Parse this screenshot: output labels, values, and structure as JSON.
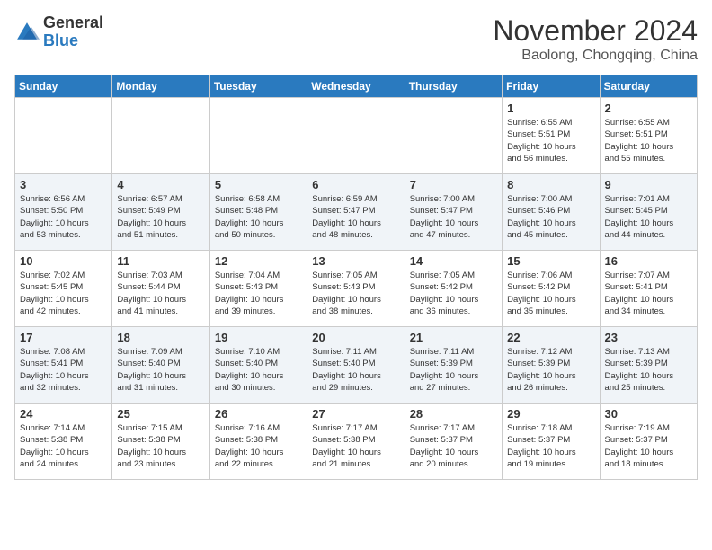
{
  "header": {
    "logo_general": "General",
    "logo_blue": "Blue",
    "month_title": "November 2024",
    "location": "Baolong, Chongqing, China"
  },
  "days_of_week": [
    "Sunday",
    "Monday",
    "Tuesday",
    "Wednesday",
    "Thursday",
    "Friday",
    "Saturday"
  ],
  "weeks": [
    [
      {
        "day": "",
        "info": ""
      },
      {
        "day": "",
        "info": ""
      },
      {
        "day": "",
        "info": ""
      },
      {
        "day": "",
        "info": ""
      },
      {
        "day": "",
        "info": ""
      },
      {
        "day": "1",
        "info": "Sunrise: 6:55 AM\nSunset: 5:51 PM\nDaylight: 10 hours\nand 56 minutes."
      },
      {
        "day": "2",
        "info": "Sunrise: 6:55 AM\nSunset: 5:51 PM\nDaylight: 10 hours\nand 55 minutes."
      }
    ],
    [
      {
        "day": "3",
        "info": "Sunrise: 6:56 AM\nSunset: 5:50 PM\nDaylight: 10 hours\nand 53 minutes."
      },
      {
        "day": "4",
        "info": "Sunrise: 6:57 AM\nSunset: 5:49 PM\nDaylight: 10 hours\nand 51 minutes."
      },
      {
        "day": "5",
        "info": "Sunrise: 6:58 AM\nSunset: 5:48 PM\nDaylight: 10 hours\nand 50 minutes."
      },
      {
        "day": "6",
        "info": "Sunrise: 6:59 AM\nSunset: 5:47 PM\nDaylight: 10 hours\nand 48 minutes."
      },
      {
        "day": "7",
        "info": "Sunrise: 7:00 AM\nSunset: 5:47 PM\nDaylight: 10 hours\nand 47 minutes."
      },
      {
        "day": "8",
        "info": "Sunrise: 7:00 AM\nSunset: 5:46 PM\nDaylight: 10 hours\nand 45 minutes."
      },
      {
        "day": "9",
        "info": "Sunrise: 7:01 AM\nSunset: 5:45 PM\nDaylight: 10 hours\nand 44 minutes."
      }
    ],
    [
      {
        "day": "10",
        "info": "Sunrise: 7:02 AM\nSunset: 5:45 PM\nDaylight: 10 hours\nand 42 minutes."
      },
      {
        "day": "11",
        "info": "Sunrise: 7:03 AM\nSunset: 5:44 PM\nDaylight: 10 hours\nand 41 minutes."
      },
      {
        "day": "12",
        "info": "Sunrise: 7:04 AM\nSunset: 5:43 PM\nDaylight: 10 hours\nand 39 minutes."
      },
      {
        "day": "13",
        "info": "Sunrise: 7:05 AM\nSunset: 5:43 PM\nDaylight: 10 hours\nand 38 minutes."
      },
      {
        "day": "14",
        "info": "Sunrise: 7:05 AM\nSunset: 5:42 PM\nDaylight: 10 hours\nand 36 minutes."
      },
      {
        "day": "15",
        "info": "Sunrise: 7:06 AM\nSunset: 5:42 PM\nDaylight: 10 hours\nand 35 minutes."
      },
      {
        "day": "16",
        "info": "Sunrise: 7:07 AM\nSunset: 5:41 PM\nDaylight: 10 hours\nand 34 minutes."
      }
    ],
    [
      {
        "day": "17",
        "info": "Sunrise: 7:08 AM\nSunset: 5:41 PM\nDaylight: 10 hours\nand 32 minutes."
      },
      {
        "day": "18",
        "info": "Sunrise: 7:09 AM\nSunset: 5:40 PM\nDaylight: 10 hours\nand 31 minutes."
      },
      {
        "day": "19",
        "info": "Sunrise: 7:10 AM\nSunset: 5:40 PM\nDaylight: 10 hours\nand 30 minutes."
      },
      {
        "day": "20",
        "info": "Sunrise: 7:11 AM\nSunset: 5:40 PM\nDaylight: 10 hours\nand 29 minutes."
      },
      {
        "day": "21",
        "info": "Sunrise: 7:11 AM\nSunset: 5:39 PM\nDaylight: 10 hours\nand 27 minutes."
      },
      {
        "day": "22",
        "info": "Sunrise: 7:12 AM\nSunset: 5:39 PM\nDaylight: 10 hours\nand 26 minutes."
      },
      {
        "day": "23",
        "info": "Sunrise: 7:13 AM\nSunset: 5:39 PM\nDaylight: 10 hours\nand 25 minutes."
      }
    ],
    [
      {
        "day": "24",
        "info": "Sunrise: 7:14 AM\nSunset: 5:38 PM\nDaylight: 10 hours\nand 24 minutes."
      },
      {
        "day": "25",
        "info": "Sunrise: 7:15 AM\nSunset: 5:38 PM\nDaylight: 10 hours\nand 23 minutes."
      },
      {
        "day": "26",
        "info": "Sunrise: 7:16 AM\nSunset: 5:38 PM\nDaylight: 10 hours\nand 22 minutes."
      },
      {
        "day": "27",
        "info": "Sunrise: 7:17 AM\nSunset: 5:38 PM\nDaylight: 10 hours\nand 21 minutes."
      },
      {
        "day": "28",
        "info": "Sunrise: 7:17 AM\nSunset: 5:37 PM\nDaylight: 10 hours\nand 20 minutes."
      },
      {
        "day": "29",
        "info": "Sunrise: 7:18 AM\nSunset: 5:37 PM\nDaylight: 10 hours\nand 19 minutes."
      },
      {
        "day": "30",
        "info": "Sunrise: 7:19 AM\nSunset: 5:37 PM\nDaylight: 10 hours\nand 18 minutes."
      }
    ]
  ]
}
